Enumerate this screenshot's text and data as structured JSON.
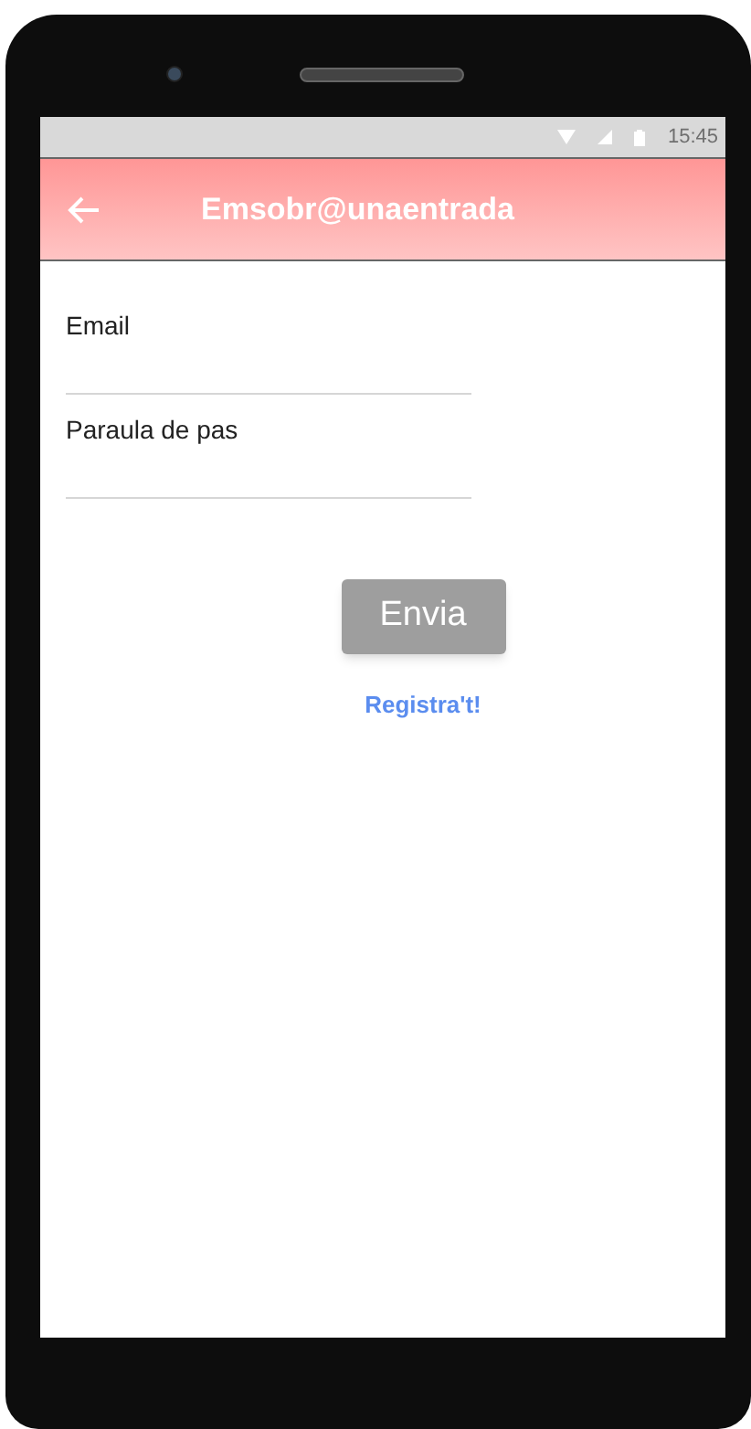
{
  "status_bar": {
    "time": "15:45"
  },
  "app_bar": {
    "title": "Emsobr@unaentrada"
  },
  "fields": [
    {
      "placeholder": "Email"
    },
    {
      "placeholder": "Paraula de pas"
    }
  ],
  "submit_button": {
    "label": "Envia"
  },
  "register_link": {
    "label": "Registra't!"
  }
}
